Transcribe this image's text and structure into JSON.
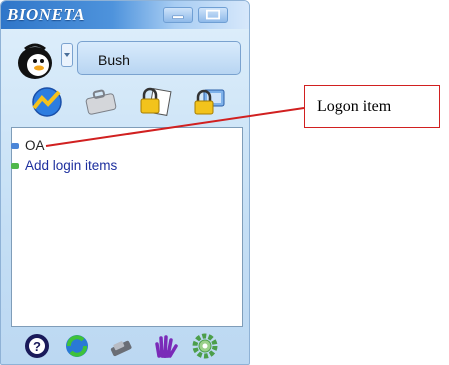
{
  "window": {
    "brand": "BIONETA",
    "controls": {
      "minimize_icon": "minimize-icon",
      "maximize_icon": "maximize-icon"
    }
  },
  "user": {
    "name": "Bush",
    "avatar_icon": "penguin-avatar-icon",
    "dropdown_icon": "chevron-down-icon"
  },
  "toolbar": {
    "icons": [
      "chart-icon",
      "briefcase-icon",
      "lock-clipboard-icon",
      "lock-monitor-icon"
    ]
  },
  "list": {
    "items": [
      {
        "label": "OA",
        "bullet_color": "#4a86d8"
      },
      {
        "label": "Add login items",
        "bullet_color": "#4fb84a"
      }
    ]
  },
  "bottom_bar": {
    "icons": [
      "help-icon",
      "refresh-icon",
      "fingerprint-icon",
      "hand-icon",
      "gear-icon"
    ]
  },
  "annotation": {
    "label": "Logon item",
    "color": "#d12020"
  }
}
